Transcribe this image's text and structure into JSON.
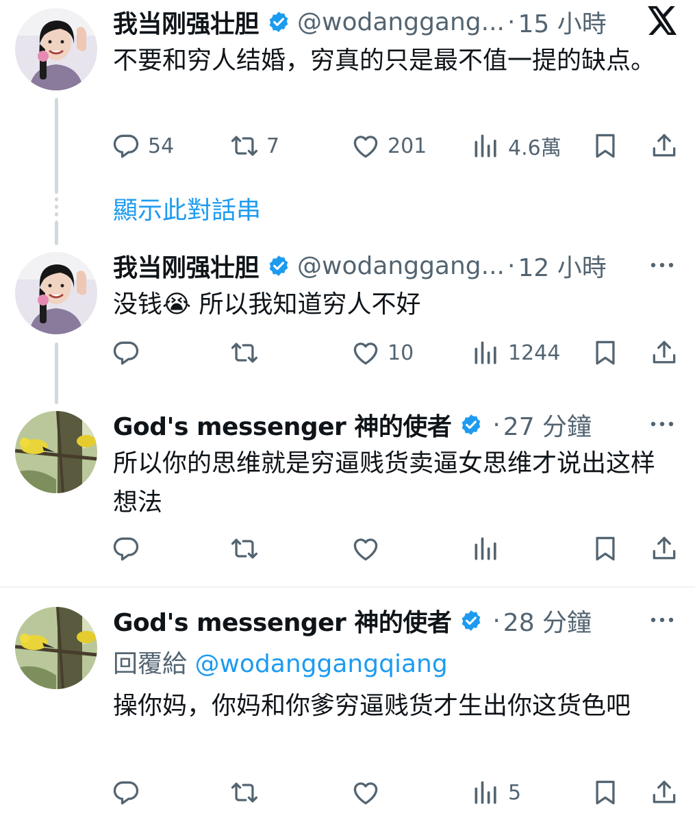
{
  "app": {
    "logo_icon": "x-logo-icon",
    "accent": "#1d9bf0",
    "secondary_text": "#536471"
  },
  "show_thread_label": "顯示此對話串",
  "tweets": [
    {
      "name": "我当刚强壮胆",
      "handle": "@wodanggang...",
      "dot": "·",
      "time": "15 小時",
      "text": "不要和穷人结婚，穷真的只是最不值一提的缺点。",
      "reply_count": "54",
      "retweet_count": "7",
      "like_count": "201",
      "view_count": "4.6萬"
    },
    {
      "name": "我当刚强壮胆",
      "handle": "@wodanggang...",
      "dot": "·",
      "time": "12 小時",
      "text": "没钱😭 所以我知道穷人不好",
      "reply_count": "",
      "retweet_count": "",
      "like_count": "10",
      "view_count": "1244"
    },
    {
      "name": "God's messenger 神的使者",
      "handle": "",
      "dot": "·",
      "time": "27 分鐘",
      "text": "所以你的思维就是穷逼贱货卖逼女思维才说出这样想法",
      "reply_count": "",
      "retweet_count": "",
      "like_count": "",
      "view_count": ""
    },
    {
      "name": "God's messenger 神的使者",
      "handle": "",
      "dot": "·",
      "time": "28 分鐘",
      "reply_prefix": "回覆給",
      "reply_mention": "@wodanggangqiang",
      "text": "操你妈，你妈和你爹穷逼贱货才生出你这货色吧",
      "reply_count": "",
      "retweet_count": "",
      "like_count": "",
      "view_count": "5"
    }
  ]
}
